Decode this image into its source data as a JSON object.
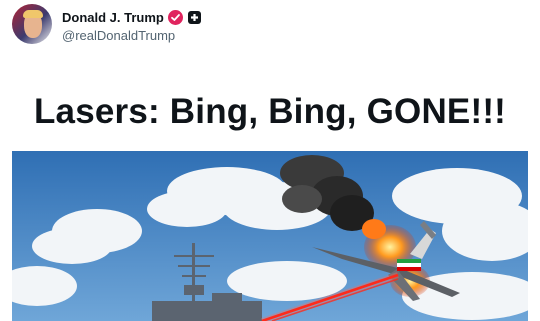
{
  "post": {
    "author": {
      "display_name": "Donald J. Trump",
      "handle": "@realDonaldTrump",
      "verified_icon": "verified-badge-icon",
      "affiliate_icon": "affiliate-badge-icon"
    },
    "headline": "Lasers: Bing, Bing, GONE!!!",
    "media": {
      "icons": [
        "warship-icon",
        "drone-icon",
        "explosion-icon",
        "laser-beam-icon",
        "iran-flag-icon"
      ]
    }
  },
  "colors": {
    "verified_badge": "#e0245e",
    "laser": "#ff2a1a",
    "sky": "#3f82c4"
  }
}
